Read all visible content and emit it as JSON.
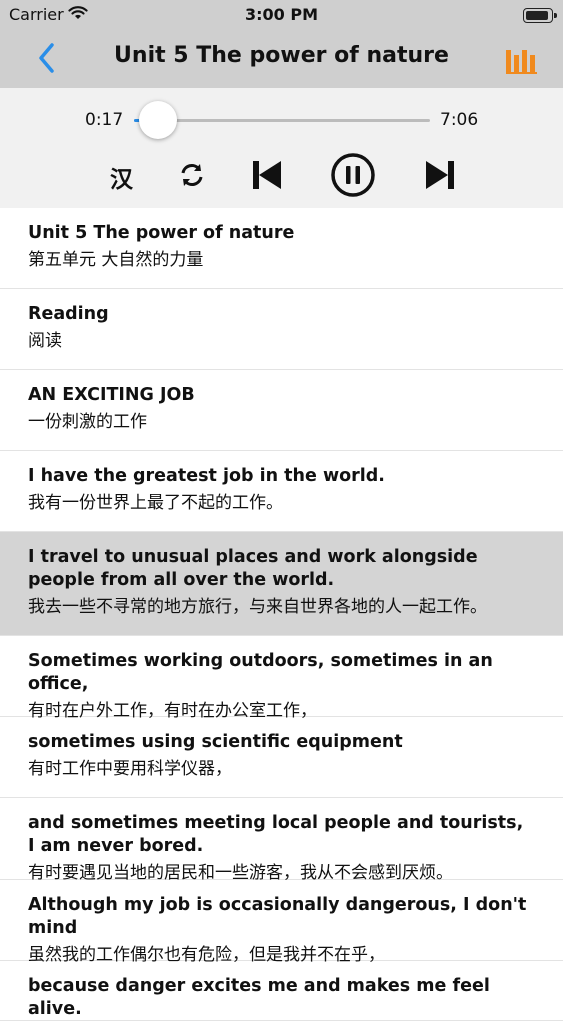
{
  "status_bar": {
    "carrier": "Carrier",
    "time": "3:00 PM",
    "wifi_icon": "wifi-icon",
    "battery_icon": "battery-icon"
  },
  "nav": {
    "title": "Unit 5 The power of nature",
    "back_icon": "chevron-left-icon",
    "menu_icon": "bars-icon",
    "accent": "#2a8ee8",
    "menu_color": "#f08a1e"
  },
  "player": {
    "current_time": "0:17",
    "total_time": "7:06",
    "progress": 0.04,
    "chinese_toggle": "汉",
    "controls": [
      "repeat-icon",
      "previous-icon",
      "pause-icon",
      "next-icon"
    ]
  },
  "sentences": [
    {
      "en": "Unit 5 The power of nature",
      "zh": "第五单元 大自然的力量"
    },
    {
      "en": "Reading",
      "zh": "阅读"
    },
    {
      "en": "AN EXCITING JOB",
      "zh": "一份刺激的工作"
    },
    {
      "en": "I have the greatest job in the world.",
      "zh": "我有一份世界上最了不起的工作。"
    },
    {
      "en": "I travel to unusual places and work alongside people from all over the world.",
      "zh": "我去一些不寻常的地方旅行，与来自世界各地的人一起工作。",
      "active": true
    },
    {
      "en": "Sometimes working outdoors, sometimes in an office,",
      "zh": "有时在户外工作，有时在办公室工作，"
    },
    {
      "en": "sometimes using scientific equipment",
      "zh": "有时工作中要用科学仪器，"
    },
    {
      "en": "and sometimes meeting local people and tourists, I am never bored.",
      "zh": "有时要遇见当地的居民和一些游客，我从不会感到厌烦。"
    },
    {
      "en": "Although my job is occasionally dangerous, I don't mind",
      "zh": "虽然我的工作偶尔也有危险，但是我并不在乎，"
    },
    {
      "en": "because danger excites me and makes me feel alive.",
      "zh": ""
    }
  ]
}
